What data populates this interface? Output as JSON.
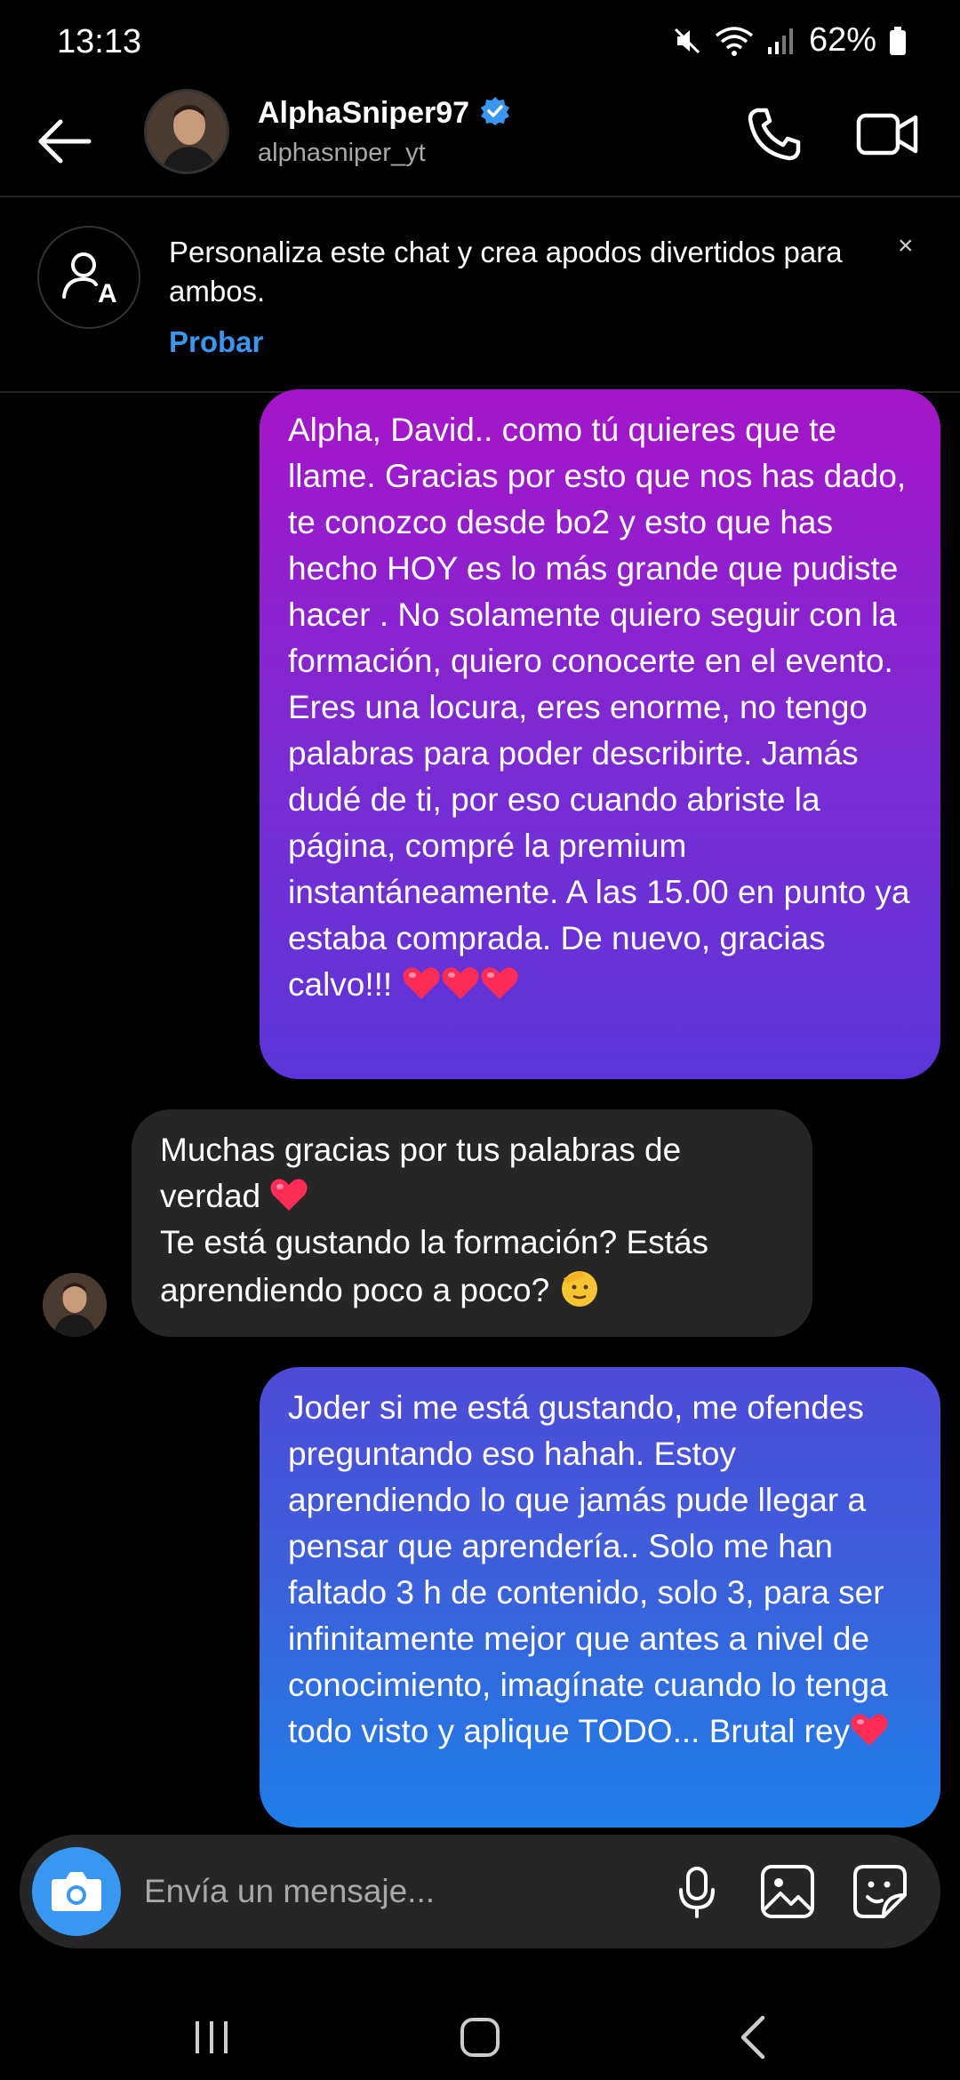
{
  "status_bar": {
    "time": "13:13",
    "battery": "62%",
    "icons": [
      "mute-icon",
      "wifi-icon",
      "signal-icon",
      "battery-icon"
    ]
  },
  "header": {
    "name": "AlphaSniper97",
    "handle": "alphasniper_yt",
    "verified": true,
    "icons": [
      "back-arrow-icon",
      "phone-icon",
      "video-camera-icon"
    ]
  },
  "banner": {
    "text": "Personaliza este chat y crea apodos divertidos para ambos.",
    "cta": "Probar",
    "close": "×"
  },
  "messages": [
    {
      "direction": "outgoing",
      "text": "Alpha, David.. como tú quieres que te llame. Gracias por esto que nos has dado, te conozco desde bo2 y esto que has hecho HOY es lo más grande que pudiste hacer . No solamente quiero seguir con la formación, quiero conocerte en el evento. Eres una locura, eres enorme, no tengo palabras para poder describirte. Jamás dudé de ti, por eso cuando abriste la página, compré la premium instantáneamente. A las 15.00 en punto ya estaba comprada. De nuevo, gracias calvo!!!",
      "trailing_emoji": [
        "heart",
        "heart",
        "heart"
      ]
    },
    {
      "direction": "incoming",
      "line1": "Muchas gracias por tus palabras de verdad",
      "line1_emoji": "heart",
      "line2": "Te está gustando la formación? Estás aprendiendo poco a poco?",
      "line2_emoji": "saluting-face"
    },
    {
      "direction": "outgoing",
      "text": "Joder si me está gustando, me ofendes preguntando eso hahah. Estoy aprendiendo lo que jamás pude llegar a pensar que aprendería.. Solo me han faltado 3 h de contenido, solo 3, para ser infinitamente mejor que antes a nivel de conocimiento, imagínate cuando lo tenga todo visto y aplique TODO... Brutal rey",
      "trailing_emoji": [
        "heart"
      ]
    }
  ],
  "composer": {
    "placeholder": "Envía un mensaje...",
    "icons": [
      "camera-icon",
      "microphone-icon",
      "gallery-icon",
      "sticker-icon"
    ]
  },
  "nav_bar": {
    "icons": [
      "recents-icon",
      "home-icon",
      "back-icon"
    ]
  },
  "colors": {
    "accent": "#3897f0",
    "incoming_bubble": "#262626",
    "outgoing_top": "#a515c9",
    "outgoing_bottom": "#1f7ee8",
    "heart": "#ff2d55"
  }
}
